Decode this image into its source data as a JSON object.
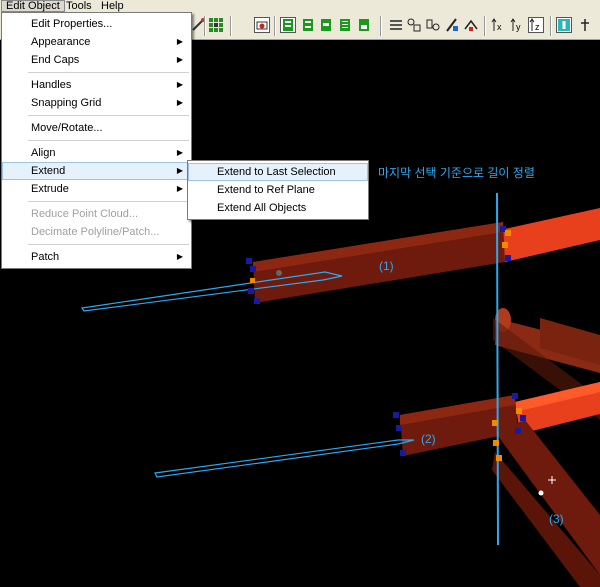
{
  "menubar": {
    "items": [
      "Edit Object",
      "Tools",
      "Help"
    ]
  },
  "edit_menu": {
    "items": [
      {
        "label": "Edit Properties...",
        "submenu": false,
        "disabled": false
      },
      {
        "label": "Appearance",
        "submenu": true,
        "disabled": false
      },
      {
        "label": "End Caps",
        "submenu": true,
        "disabled": false
      },
      {
        "label": "Handles",
        "submenu": true,
        "disabled": false
      },
      {
        "label": "Snapping Grid",
        "submenu": true,
        "disabled": false
      },
      {
        "label": "Move/Rotate...",
        "submenu": false,
        "disabled": false
      },
      {
        "label": "Align",
        "submenu": true,
        "disabled": false
      },
      {
        "label": "Extend",
        "submenu": true,
        "disabled": false,
        "highlighted": true
      },
      {
        "label": "Extrude",
        "submenu": true,
        "disabled": false
      },
      {
        "label": "Reduce Point Cloud...",
        "submenu": false,
        "disabled": true
      },
      {
        "label": "Decimate Polyline/Patch...",
        "submenu": false,
        "disabled": true
      },
      {
        "label": "Patch",
        "submenu": true,
        "disabled": false
      }
    ]
  },
  "extend_submenu": {
    "items": [
      {
        "label": "Extend to Last Selection",
        "highlighted": true
      },
      {
        "label": "Extend to Ref Plane",
        "highlighted": false
      },
      {
        "label": "Extend All Objects",
        "highlighted": false
      }
    ]
  },
  "toolbar": {
    "icons": [
      "grid-snap-icon",
      "render-icon",
      "view-green-1-icon",
      "view-green-2-icon",
      "view-green-3-icon",
      "view-green-4-icon",
      "view-green-5-icon",
      "layers-icon",
      "edit-object-icon",
      "point-cloud-icon",
      "select-tool-icon",
      "fit-icon",
      "axis-x-icon",
      "axis-y-icon",
      "axis-z-icon",
      "info-icon",
      "pin-icon"
    ],
    "axis_labels": [
      "x",
      "y",
      "z"
    ]
  },
  "viewport": {
    "annotation_title": "마지막 선택 기준으로 길이 정렬",
    "labels": [
      "(1)",
      "(2)",
      "(3)"
    ],
    "colors": {
      "beam": "#6e1a0c",
      "beam_highlight": "#e8401c",
      "annotation": "#2ea8f0",
      "handle": "#1a1aa0",
      "handle_active": "#f08a00"
    }
  }
}
